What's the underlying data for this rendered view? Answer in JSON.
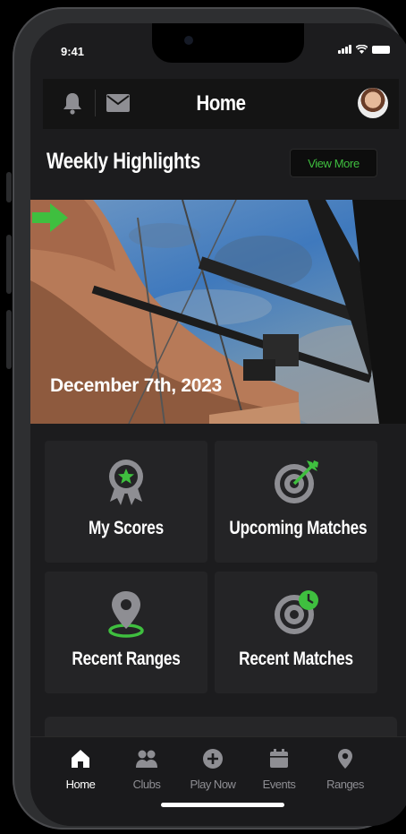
{
  "status_bar": {
    "time": "9:41"
  },
  "header": {
    "title": "Home"
  },
  "highlights": {
    "title": "Weekly Highlights",
    "view_more_label": "View More",
    "date": "December 7th, 2023"
  },
  "tiles": [
    {
      "label": "My Scores",
      "icon": "award-badge-icon"
    },
    {
      "label": "Upcoming Matches",
      "icon": "target-arrow-icon"
    },
    {
      "label": "Recent Ranges",
      "icon": "location-pin-icon"
    },
    {
      "label": "Recent Matches",
      "icon": "target-clock-icon"
    }
  ],
  "tabbar": {
    "items": [
      {
        "label": "Home",
        "icon": "home-icon",
        "active": true
      },
      {
        "label": "Clubs",
        "icon": "people-icon",
        "active": false
      },
      {
        "label": "Play Now",
        "icon": "plus-circle-icon",
        "active": false
      },
      {
        "label": "Events",
        "icon": "calendar-icon",
        "active": false
      },
      {
        "label": "Ranges",
        "icon": "map-pin-icon",
        "active": false
      }
    ]
  },
  "colors": {
    "accent": "#3fbf3f",
    "background": "#1c1c1e",
    "tile": "#242426",
    "icon_gray": "#8e8e93"
  }
}
